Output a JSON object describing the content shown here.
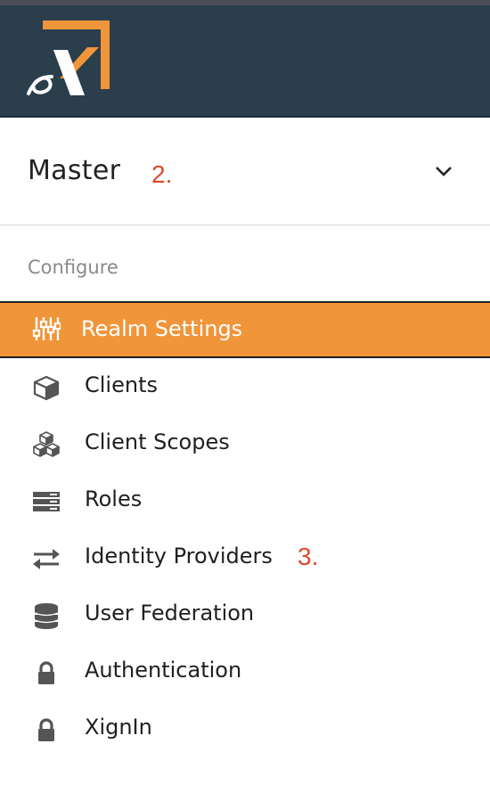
{
  "header": {
    "logo_icon": "xignin-x-logo"
  },
  "realm": {
    "name": "Master",
    "dropdown_icon": "chevron-down-icon"
  },
  "annotations": {
    "realm": "2.",
    "identity_providers": "3."
  },
  "nav": {
    "section_label": "Configure",
    "items": [
      {
        "label": "Realm Settings",
        "icon": "sliders-icon",
        "active": true
      },
      {
        "label": "Clients",
        "icon": "cube-icon"
      },
      {
        "label": "Client Scopes",
        "icon": "cubes-icon"
      },
      {
        "label": "Roles",
        "icon": "list-bars-icon"
      },
      {
        "label": "Identity Providers",
        "icon": "exchange-arrows-icon"
      },
      {
        "label": "User Federation",
        "icon": "database-icon"
      },
      {
        "label": "Authentication",
        "icon": "lock-icon"
      },
      {
        "label": "XignIn",
        "icon": "lock-icon"
      }
    ]
  },
  "colors": {
    "header_bg": "#2b3e4c",
    "accent": "#f0953a",
    "annotation": "#e0482a"
  }
}
